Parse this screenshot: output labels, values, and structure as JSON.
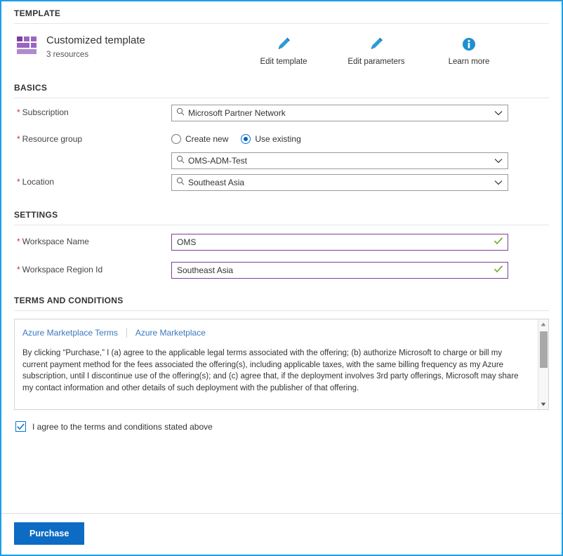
{
  "sections": {
    "template": "TEMPLATE",
    "basics": "BASICS",
    "settings": "SETTINGS",
    "terms": "TERMS AND CONDITIONS"
  },
  "template": {
    "icon": "template-grid-icon",
    "title": "Customized template",
    "subtitle": "3 resources",
    "actions": [
      {
        "label": "Edit template",
        "icon": "pencil-icon"
      },
      {
        "label": "Edit parameters",
        "icon": "pencil-icon"
      },
      {
        "label": "Learn more",
        "icon": "info-icon"
      }
    ]
  },
  "basics": {
    "subscription": {
      "label": "Subscription",
      "required": "*",
      "value": "Microsoft Partner Network",
      "search_icon": "search-icon",
      "chevron_icon": "chevron-down-icon"
    },
    "resource_group": {
      "label": "Resource group",
      "required": "*",
      "options": [
        {
          "label": "Create new",
          "selected": false
        },
        {
          "label": "Use existing",
          "selected": true
        }
      ],
      "value": "OMS-ADM-Test",
      "search_icon": "search-icon",
      "chevron_icon": "chevron-down-icon"
    },
    "location": {
      "label": "Location",
      "required": "*",
      "value": "Southeast Asia",
      "search_icon": "search-icon",
      "chevron_icon": "chevron-down-icon"
    }
  },
  "settings": {
    "fields": [
      {
        "label": "Workspace Name",
        "required": "*",
        "value": "OMS",
        "valid_icon": "checkmark-icon"
      },
      {
        "label": "Workspace Region Id",
        "required": "*",
        "value": "Southeast Asia",
        "valid_icon": "checkmark-icon"
      }
    ]
  },
  "terms": {
    "links": [
      "Azure Marketplace Terms",
      "Azure Marketplace"
    ],
    "legal_text": "By clicking “Purchase,” I (a) agree to the applicable legal terms associated with the offering; (b) authorize Microsoft to charge or bill my current payment method for the fees associated the offering(s), including applicable taxes, with the same billing frequency as my Azure subscription, until I discontinue use of the offering(s); and (c) agree that, if the deployment involves 3rd party offerings, Microsoft may share my contact information and other details of such deployment with the publisher of that offering.",
    "scroll_up_icon": "scroll-up-arrow-icon",
    "scroll_down_icon": "scroll-down-arrow-icon",
    "agree": {
      "checked": true,
      "label": "I agree to the terms and conditions stated above"
    }
  },
  "footer": {
    "purchase_label": "Purchase"
  },
  "colors": {
    "accent": "#19a0e8",
    "purchase_button": "#0d6bc4",
    "link": "#3b78bd",
    "required_asterisk": "#d02b2b",
    "valid_check": "#6aa72b",
    "input_valid_border": "#7f3f98",
    "template_icon": "#9a66bf",
    "radio_selected": "#0a5fc4"
  }
}
